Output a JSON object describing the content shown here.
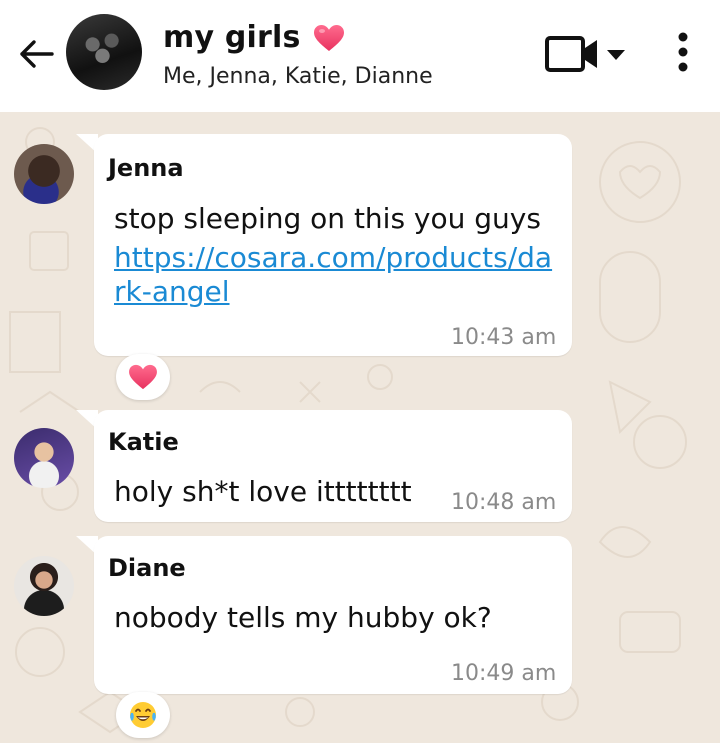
{
  "header": {
    "back_icon": "arrow-left-icon",
    "title": "my girls",
    "title_emoji": "heart-emoji",
    "members": "Me, Jenna, Katie, Dianne",
    "video_icon": "video-camera-icon",
    "dropdown_icon": "caret-down-icon",
    "menu_icon": "more-vertical-icon"
  },
  "messages": [
    {
      "sender": "Jenna",
      "text": "stop sleeping on this you guys",
      "link_line1": "https://cosara.com/products/da",
      "link_line2": "rk-angel",
      "time": "10:43 am",
      "reaction": "heart-emoji"
    },
    {
      "sender": "Katie",
      "text": "holy sh*t love itttttttt",
      "time": "10:48 am"
    },
    {
      "sender": "Diane",
      "text": "nobody tells my hubby ok?",
      "time": "10:49 am",
      "reaction": "laughing-tears-emoji"
    }
  ],
  "colors": {
    "chat_bg": "#efe7dd",
    "link": "#1a8ad4",
    "heart": "#e8325f",
    "time": "#8a8a8a"
  }
}
